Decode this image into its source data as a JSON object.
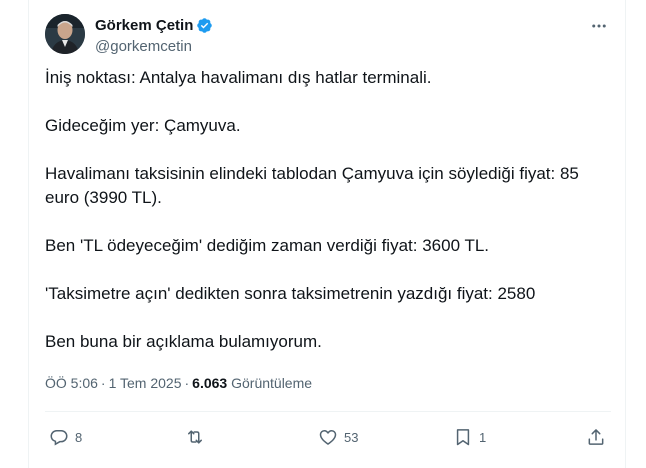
{
  "author": {
    "display_name": "Görkem Çetin",
    "handle": "@gorkemcetin",
    "verified": true
  },
  "tweet": {
    "paragraphs": [
      "İniş noktası: Antalya havalimanı dış hatlar terminali.",
      "Gideceğim yer: Çamyuva.",
      "Havalimanı taksisinin elindeki tablodan Çamyuva için söylediği fiyat: 85 euro (3990 TL).",
      "Ben 'TL ödeyeceğim' dediğim zaman verdiği fiyat: 3600 TL.",
      "'Taksimetre açın' dedikten sonra taksimetrenin yazdığı fiyat: 2580",
      "Ben buna bir açıklama bulamıyorum."
    ],
    "time": "ÖÖ 5:06",
    "date": "1 Tem 2025",
    "views_count": "6.063",
    "views_label": "Görüntüleme"
  },
  "actions": {
    "replies": "8",
    "retweets": "",
    "likes": "53",
    "bookmarks": "1"
  },
  "icons": {
    "more": "more-dots-icon",
    "reply": "reply-icon",
    "retweet": "retweet-icon",
    "like": "heart-icon",
    "bookmark": "bookmark-icon",
    "share": "share-icon",
    "verified": "verified-badge-icon"
  },
  "colors": {
    "verified_blue": "#1d9bf0",
    "secondary_text": "#536471",
    "primary_text": "#0f1419",
    "divider": "#eff3f4"
  }
}
